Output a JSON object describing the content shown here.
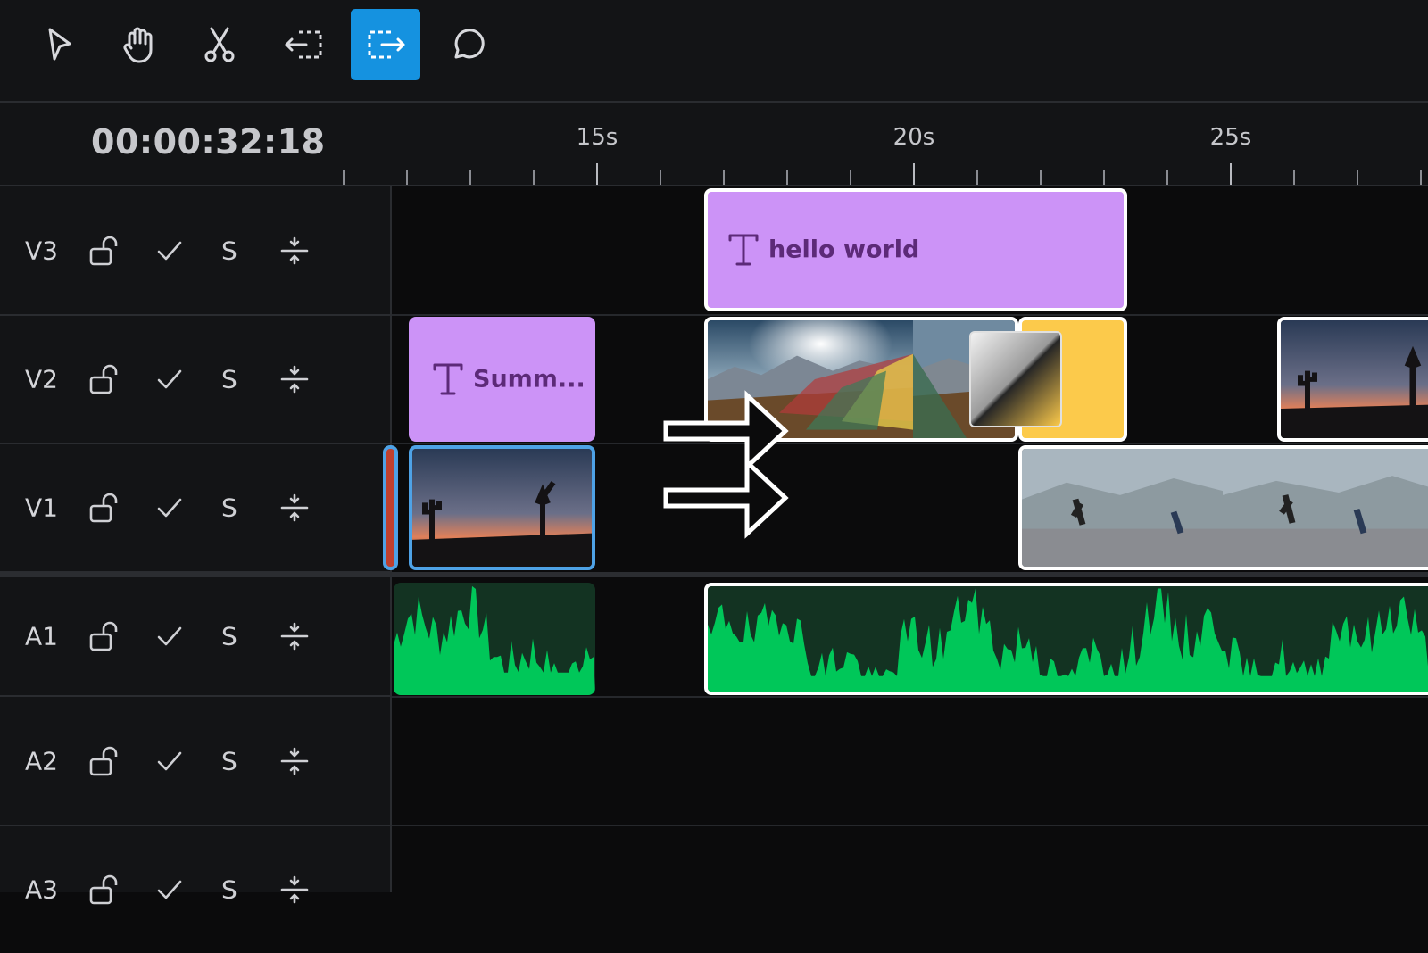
{
  "toolbar": {
    "tools": [
      {
        "name": "select-tool",
        "icon": "pointer-arrow-icon",
        "active": false
      },
      {
        "name": "hand-tool",
        "icon": "hand-icon",
        "active": false
      },
      {
        "name": "razor-tool",
        "icon": "scissors-icon",
        "active": false
      },
      {
        "name": "trim-left-tool",
        "icon": "trim-left-icon",
        "active": false
      },
      {
        "name": "trim-right-tool",
        "icon": "trim-right-icon",
        "active": true
      },
      {
        "name": "comment-tool",
        "icon": "speech-bubble-icon",
        "active": false
      }
    ],
    "accent_color": "#1592e0"
  },
  "timeline": {
    "timecode": "00:00:32:18",
    "ruler_labels": [
      {
        "text": "15s",
        "seconds": 15
      },
      {
        "text": "20s",
        "seconds": 20
      },
      {
        "text": "25s",
        "seconds": 25
      }
    ]
  },
  "tracks": [
    {
      "name": "V3",
      "solo_label": "S",
      "icons": [
        "lock-open-icon",
        "check-icon",
        "split-icon"
      ]
    },
    {
      "name": "V2",
      "solo_label": "S",
      "icons": [
        "lock-open-icon",
        "check-icon",
        "split-icon"
      ]
    },
    {
      "name": "V1",
      "solo_label": "S",
      "icons": [
        "lock-open-icon",
        "check-icon",
        "split-icon"
      ]
    },
    {
      "name": "A1",
      "solo_label": "S",
      "icons": [
        "lock-open-icon",
        "check-icon",
        "split-icon"
      ]
    },
    {
      "name": "A2",
      "solo_label": "S",
      "icons": [
        "lock-open-icon",
        "check-icon",
        "split-icon"
      ]
    },
    {
      "name": "A3",
      "solo_label": "S",
      "icons": [
        "lock-open-icon",
        "check-icon",
        "split-icon"
      ]
    }
  ],
  "clips": {
    "v3_text": {
      "label": "hello world",
      "icon": "text-icon",
      "color": "#cc93f7"
    },
    "v2_text": {
      "label": "Summ...",
      "icon": "text-icon",
      "color": "#cc93f7"
    },
    "v2_transition_color": "#fcca4b",
    "audio_color": "#00c759"
  },
  "overlay": {
    "icon": "right-arrow-icon",
    "count": 2
  }
}
